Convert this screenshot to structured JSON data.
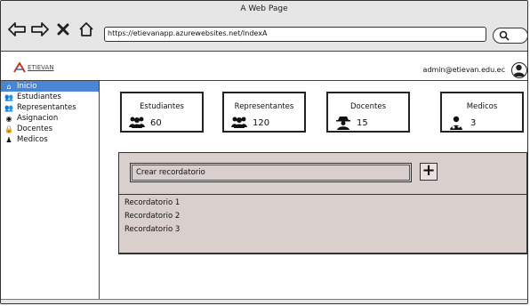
{
  "browser": {
    "title": "A Web Page",
    "url": "https://etievanapp.azurewebsites.net/IndexA"
  },
  "header": {
    "logo_text": "ETIEVAN",
    "user_email": "admin@etievan.edu.ec"
  },
  "sidebar": {
    "items": [
      {
        "label": "Inicio",
        "icon": "home-icon"
      },
      {
        "label": "Estudiantes",
        "icon": "users-icon"
      },
      {
        "label": "Representantes",
        "icon": "users-icon"
      },
      {
        "label": "Asignacion",
        "icon": "eye-icon"
      },
      {
        "label": "Docentes",
        "icon": "lock-icon"
      },
      {
        "label": "Medicos",
        "icon": "user-md-icon"
      }
    ]
  },
  "cards": [
    {
      "title": "Estudiantes",
      "value": "60"
    },
    {
      "title": "Representantes",
      "value": "120"
    },
    {
      "title": "Docentes",
      "value": "15"
    },
    {
      "title": "Medicos",
      "value": "3"
    }
  ],
  "reminders": {
    "input_placeholder": "Crear recordatorio",
    "add_label": "+",
    "items": [
      "Recordatorio 1",
      "Recordatorio 2",
      "Recordatorio 3"
    ]
  },
  "colors": {
    "accent": "#4a86d6",
    "panel": "#d9cfcd"
  }
}
